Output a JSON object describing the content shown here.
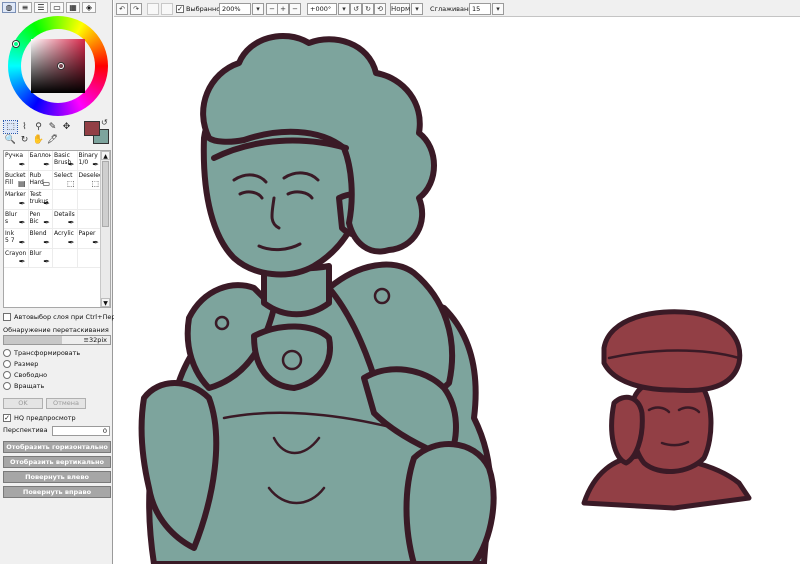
{
  "panel_tabs": [
    "color-wheel-icon",
    "layers-icon",
    "list-icon",
    "sliders-icon",
    "palette-icon",
    "navigator-icon"
  ],
  "colors": {
    "foreground": "#923f45",
    "background": "#7da49d",
    "outline": "#3a1a26"
  },
  "tools": [
    {
      "name": "select-rect-icon",
      "glyph": "⬚"
    },
    {
      "name": "lasso-icon",
      "glyph": "⌇"
    },
    {
      "name": "magic-wand-icon",
      "glyph": "⚲"
    },
    {
      "name": "pen-tool-icon",
      "glyph": "✎"
    },
    {
      "name": "move-icon",
      "glyph": "✥"
    },
    {
      "name": "zoom-icon",
      "glyph": "🔍"
    },
    {
      "name": "rotate-icon",
      "glyph": "↻"
    },
    {
      "name": "hand-icon",
      "glyph": "✋"
    },
    {
      "name": "eyedropper-icon",
      "glyph": "🖋"
    }
  ],
  "brushes": [
    {
      "label": "Ручка",
      "sub": "",
      "icon": "✒"
    },
    {
      "label": "Баллон",
      "sub": "",
      "icon": "✒"
    },
    {
      "label": "Basic",
      "sub": "Brush",
      "icon": "✒"
    },
    {
      "label": "Binary",
      "sub": "1/0",
      "icon": "✒"
    },
    {
      "label": "Bucket",
      "sub": "Fill",
      "icon": "▤"
    },
    {
      "label": "Rub",
      "sub": "Hard",
      "icon": "▭"
    },
    {
      "label": "Select",
      "sub": "",
      "icon": "⬚"
    },
    {
      "label": "Deselect",
      "sub": "",
      "icon": "⬚"
    },
    {
      "label": "Marker",
      "sub": "",
      "icon": "✒"
    },
    {
      "label": "Test",
      "sub": "trukus",
      "icon": "✒"
    },
    {
      "label": "",
      "sub": "",
      "icon": ""
    },
    {
      "label": "",
      "sub": "",
      "icon": ""
    },
    {
      "label": "Blur",
      "sub": "s",
      "icon": "✒"
    },
    {
      "label": "Pen",
      "sub": "Bic",
      "icon": "✒"
    },
    {
      "label": "Details",
      "sub": "",
      "icon": "✒"
    },
    {
      "label": "",
      "sub": "",
      "icon": ""
    },
    {
      "label": "Ink",
      "sub": "5 7",
      "icon": "✒"
    },
    {
      "label": "Blend",
      "sub": "",
      "icon": "✒"
    },
    {
      "label": "Acrylic",
      "sub": "",
      "icon": "✒"
    },
    {
      "label": "Paper",
      "sub": "",
      "icon": "✒"
    },
    {
      "label": "Crayon",
      "sub": "",
      "icon": "✒"
    },
    {
      "label": "Blur",
      "sub": "",
      "icon": "✒"
    },
    {
      "label": "",
      "sub": "",
      "icon": ""
    },
    {
      "label": "",
      "sub": "",
      "icon": ""
    }
  ],
  "options": {
    "auto_select_label": "Автовыбор слоя при Ctrl+Перетаскивание",
    "drag_detect_label": "Обнаружение перетаскивания",
    "drag_detect_value": "≡32pix",
    "transform_options": [
      "Трансформировать",
      "Размер",
      "Свободно",
      "Вращать"
    ],
    "ok_label": "OK",
    "cancel_label": "Отмена",
    "hq_preview_label": "HQ предпросмотр",
    "perspective_label": "Перспектива",
    "perspective_value": "0",
    "flip_horizontal": "Отобразить горизонтально",
    "flip_vertical": "Отобразить вертикально",
    "rotate_ccw": "Повернуть влево",
    "rotate_cw": "Повернуть вправо"
  },
  "toolbar": {
    "selection_label": "Выбранное",
    "zoom_value": "200%",
    "rotation_value": "+000°",
    "mode_label": "Норм",
    "stabilizer_label": "Сглаживание",
    "stabilizer_value": "15"
  }
}
